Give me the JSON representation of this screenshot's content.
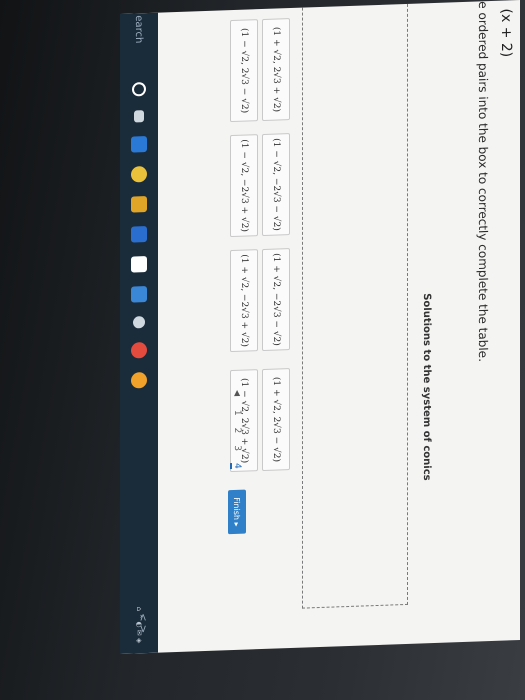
{
  "question": {
    "top_expression": "(x + 2)",
    "instruction": "e ordered pairs into the box to correctly complete the table."
  },
  "table": {
    "title": "Solutions to the system of conics"
  },
  "tiles": [
    "(1 + √2, 2√3 + √2)",
    "(1 − √2, −2√3 − √2)",
    "(1 + √2, −2√3 − √2)",
    "(1 + √2, 2√3 − √2)",
    "(1 − √2, 2√3 − √2)",
    "(1 − √2, −2√3 + √2)",
    "(1 + √2, −2√3 + √2)",
    "(1 − √2, 2√3 + √2)"
  ],
  "pager": {
    "prev": "◀",
    "pages": [
      "1",
      "2",
      "3",
      "4"
    ],
    "active_page": "4",
    "finish_label": "Finish ▸"
  },
  "taskbar": {
    "search_label": "earch",
    "icons": [
      "cortana-icon",
      "task-view-icon",
      "edge-icon",
      "chrome-icon",
      "file-explorer-icon",
      "store-icon",
      "amazon-icon",
      "dropbox-icon",
      "settings-icon",
      "app-icon",
      "app-icon-2"
    ],
    "colors": [
      "#ffffff",
      "#cfd8df",
      "#2b79d6",
      "#e9c13a",
      "#e0a526",
      "#2a6fcf",
      "#ffffff",
      "#3a87d8",
      "#cfd8df",
      "#e34b3f",
      "#f0a22a"
    ],
    "nav": "<   >"
  }
}
